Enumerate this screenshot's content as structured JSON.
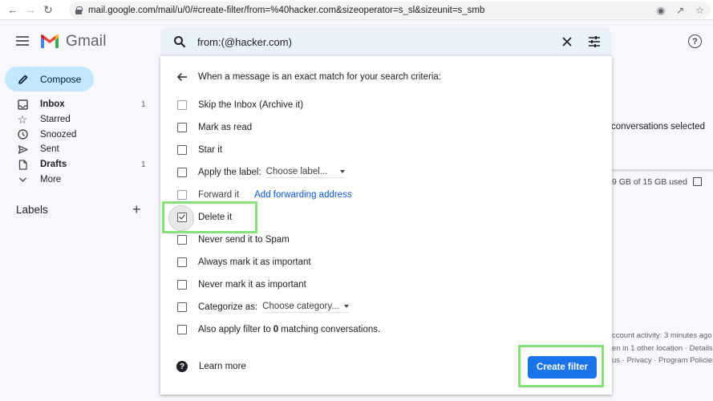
{
  "browser": {
    "url": "mail.google.com/mail/u/0/#create-filter/from=%40hacker.com&sizeoperator=s_sl&sizeunit=s_smb",
    "icons": [
      "back-icon",
      "forward-icon",
      "reload-icon",
      "lock-icon",
      "extension-icon",
      "share-icon",
      "bookmark-star-icon"
    ]
  },
  "app": {
    "name": "Gmail",
    "brand_colors": {
      "red": "#ea4335",
      "blue": "#4285f4",
      "green": "#34a853",
      "yellow": "#fbbc04"
    }
  },
  "sidebar": {
    "compose_label": "Compose",
    "items": [
      {
        "label": "Inbox",
        "count": "1",
        "icon": "inbox-icon",
        "bold": true
      },
      {
        "label": "Starred",
        "count": "",
        "icon": "star-icon",
        "bold": false
      },
      {
        "label": "Snoozed",
        "count": "",
        "icon": "clock-icon",
        "bold": false
      },
      {
        "label": "Sent",
        "count": "",
        "icon": "send-icon",
        "bold": false
      },
      {
        "label": "Drafts",
        "count": "1",
        "icon": "draft-icon",
        "bold": true
      },
      {
        "label": "More",
        "count": "",
        "icon": "chevron-down-icon",
        "bold": false
      }
    ],
    "labels_heading": "Labels",
    "labels_add": "+"
  },
  "search": {
    "query": "from:(@hacker.com)"
  },
  "background": {
    "selection_text": "conversations selected",
    "storage_text": "9 GB of 15 GB used",
    "activity_line1": "ccount activity: 3 minutes ago",
    "activity_line2": "en in 1 other location · Details",
    "activity_line3": "us · Privacy · Program Policies"
  },
  "filter_panel": {
    "heading": "When a message is an exact match for your search criteria:",
    "options": [
      {
        "label": "Skip the Inbox (Archive it)",
        "checked": false
      },
      {
        "label": "Mark as read",
        "checked": false
      },
      {
        "label": "Star it",
        "checked": false
      },
      {
        "label": "Apply the label:",
        "checked": false,
        "select": "Choose label..."
      },
      {
        "label": "Forward it",
        "checked": false,
        "link": "Add forwarding address"
      },
      {
        "label": "Delete it",
        "checked": true
      },
      {
        "label": "Never send it to Spam",
        "checked": false
      },
      {
        "label": "Always mark it as important",
        "checked": false
      },
      {
        "label": "Never mark it as important",
        "checked": false
      },
      {
        "label": "Categorize as:",
        "checked": false,
        "select": "Choose category..."
      },
      {
        "label_prefix": "Also apply filter to",
        "count": "0",
        "label_suffix": "matching conversations.",
        "checked": false
      }
    ],
    "learn_more": "Learn more",
    "create_button": "Create filter",
    "button_color": "#1a73e8"
  },
  "annotations": {
    "highlight_color": "#88e07a",
    "highlighted": [
      "Delete it",
      "Create filter"
    ]
  }
}
